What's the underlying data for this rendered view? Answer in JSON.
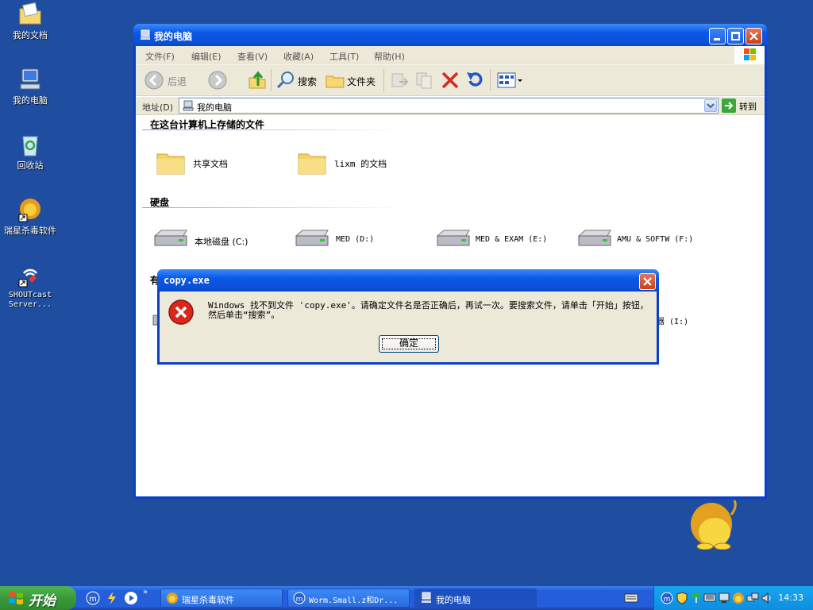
{
  "desktop": {
    "icons": [
      {
        "label": "我的文档"
      },
      {
        "label": "我的电脑"
      },
      {
        "label": "回收站"
      },
      {
        "label": "瑞星杀毒软件"
      },
      {
        "label": "SHOUTcast Server..."
      }
    ]
  },
  "window": {
    "title": "我的电脑",
    "menu": [
      "文件(F)",
      "编辑(E)",
      "查看(V)",
      "收藏(A)",
      "工具(T)",
      "帮助(H)"
    ],
    "toolbar": {
      "back": "后退",
      "search": "搜索",
      "folders": "文件夹"
    },
    "address": {
      "label": "地址(D)",
      "value": "我的电脑",
      "go": "转到"
    },
    "sections": {
      "stored": "在这台计算机上存储的文件",
      "drives": "硬盘",
      "removable": "有"
    },
    "stored_items": [
      "共享文档",
      "lixm 的文档"
    ],
    "drives": [
      "本地磁盘 (C:)",
      "MED (D:)",
      "MED & EXAM (E:)",
      "AMU & SOFTW (F:)"
    ],
    "partial_drive": "器 (I:)"
  },
  "dialog": {
    "title": "copy.exe",
    "message": "Windows 找不到文件 'copy.exe'。请确定文件名是否正确后，再试一次。要搜索文件，请单击「开始」按钮，然后单击“搜索”。",
    "ok": "确定"
  },
  "taskbar": {
    "start": "开始",
    "tasks": [
      "瑞星杀毒软件",
      "Worm.Small.z和Dr...",
      "我的电脑"
    ],
    "clock": "14:33"
  },
  "colors": {
    "desktop": "#1f4ea0",
    "titlebar": "#0a58e8",
    "start": "#3a9a3a"
  }
}
